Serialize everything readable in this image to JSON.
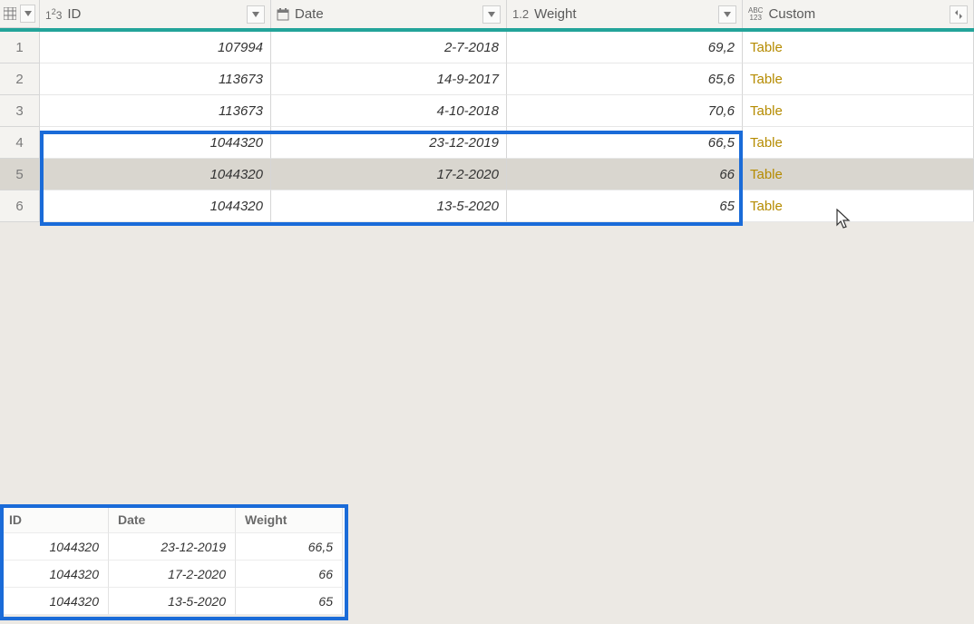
{
  "columns": {
    "id": {
      "label": "ID",
      "type_icon": "int-icon"
    },
    "date": {
      "label": "Date",
      "type_icon": "date-icon"
    },
    "weight": {
      "label": "Weight",
      "type_icon": "decimal-icon"
    },
    "custom": {
      "label": "Custom",
      "type_icon": "any-icon"
    }
  },
  "type_labels": {
    "int": "1²3",
    "decimal": "1.2",
    "any_top": "ABC",
    "any_bot": "123"
  },
  "rows": [
    {
      "n": "1",
      "id": "107994",
      "date": "2-7-2018",
      "weight": "69,2",
      "custom": "Table",
      "selected": false
    },
    {
      "n": "2",
      "id": "113673",
      "date": "14-9-2017",
      "weight": "65,6",
      "custom": "Table",
      "selected": false
    },
    {
      "n": "3",
      "id": "113673",
      "date": "4-10-2018",
      "weight": "70,6",
      "custom": "Table",
      "selected": false
    },
    {
      "n": "4",
      "id": "1044320",
      "date": "23-12-2019",
      "weight": "66,5",
      "custom": "Table",
      "selected": false
    },
    {
      "n": "5",
      "id": "1044320",
      "date": "17-2-2020",
      "weight": "66",
      "custom": "Table",
      "selected": true
    },
    {
      "n": "6",
      "id": "1044320",
      "date": "13-5-2020",
      "weight": "65",
      "custom": "Table",
      "selected": false
    }
  ],
  "preview": {
    "headers": {
      "id": "ID",
      "date": "Date",
      "weight": "Weight"
    },
    "rows": [
      {
        "id": "1044320",
        "date": "23-12-2019",
        "weight": "66,5"
      },
      {
        "id": "1044320",
        "date": "17-2-2020",
        "weight": "66"
      },
      {
        "id": "1044320",
        "date": "13-5-2020",
        "weight": "65"
      }
    ]
  }
}
